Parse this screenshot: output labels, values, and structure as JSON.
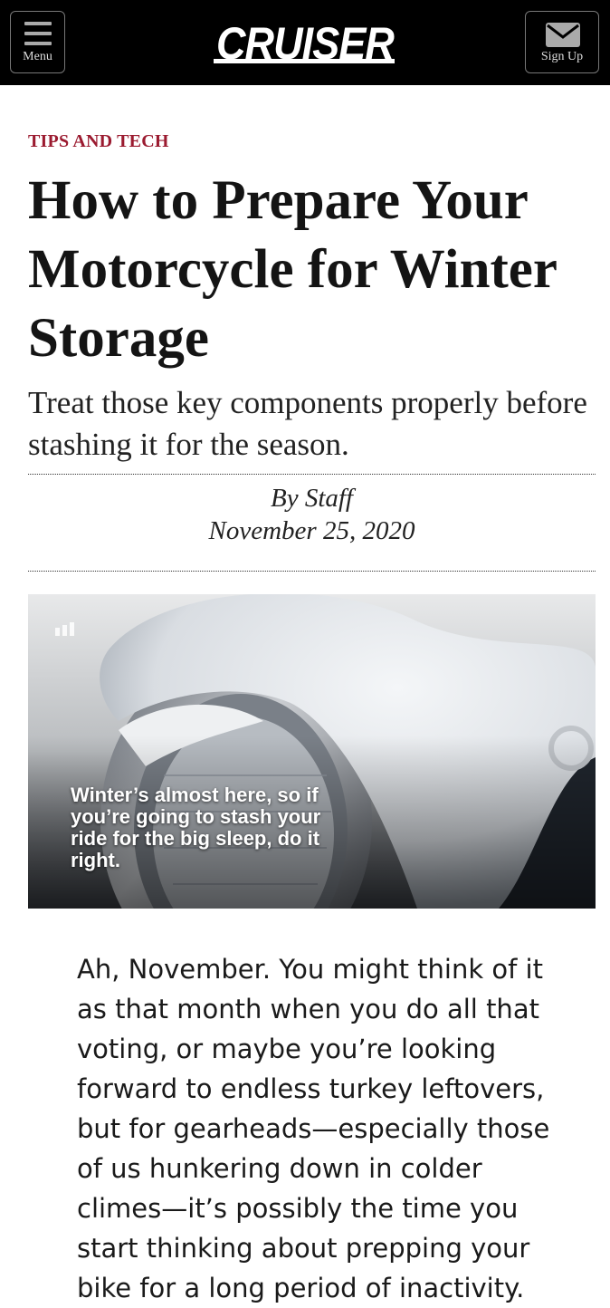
{
  "header": {
    "menu_label": "Menu",
    "logo_text": "CRUISER",
    "signup_label": "Sign Up"
  },
  "article": {
    "kicker": "TIPS AND TECH",
    "title": "How to Prepare Your Motorcycle for Winter Storage",
    "dek": "Treat those key components properly before stashing it for the season.",
    "byline": "By Staff",
    "date": "November 25, 2020",
    "hero_caption": "Winter’s almost here, so if you’re going to stash your ride for the big sleep, do it right.",
    "body_first_paragraph": "Ah, November. You might think of it as that month when you do all that voting, or maybe you’re looking forward to endless turkey leftovers, but for gearheads—especially those of us hunkering down in colder climes—it’s possibly the time you start thinking about prepping your bike for a long period of inactivity."
  },
  "colors": {
    "header_bg": "#000000",
    "kicker": "#9b1b30"
  },
  "icons": {
    "menu": "hamburger-icon",
    "signup": "envelope-icon",
    "hero_badge": "signal-bars-icon"
  }
}
